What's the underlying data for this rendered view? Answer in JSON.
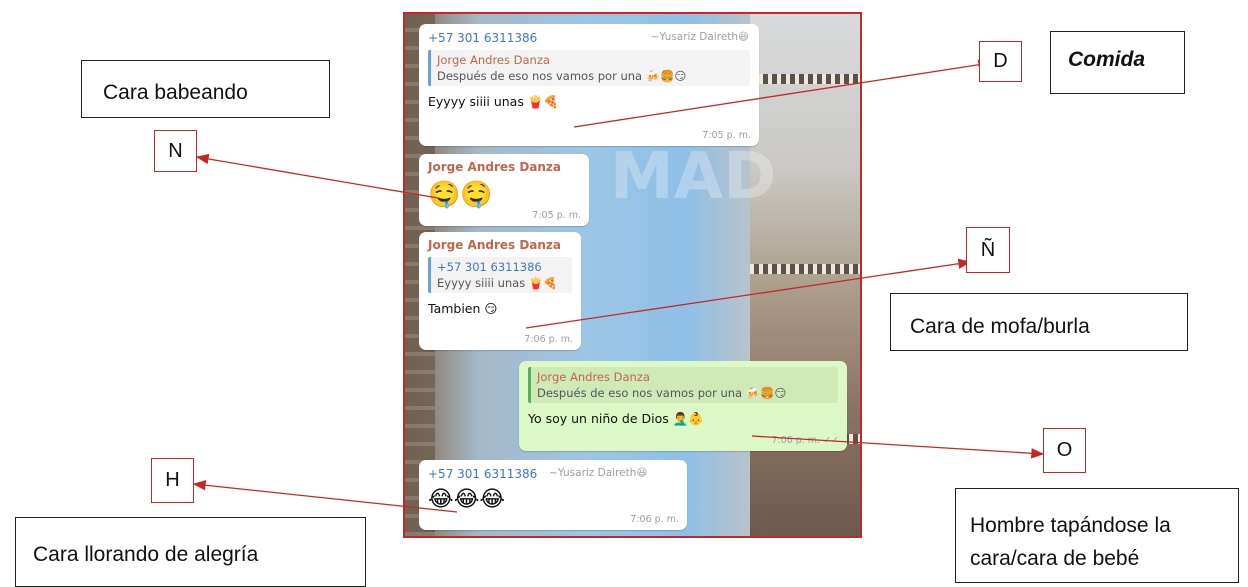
{
  "screenshot": {
    "watermark": "MAD",
    "messages": [
      {
        "phone": "+57 301 6311386",
        "alias": "~Yusariz Daireth😆",
        "quote_author": "Jorge Andres Danza",
        "quote_text": "Después de eso nos vamos por una 🍻🍔😏",
        "text": "Eyyyy siiii unas 🍟🍕",
        "time": "7:05 p. m."
      },
      {
        "author": "Jorge Andres Danza",
        "text": "🤤🤤",
        "time": "7:05 p. m."
      },
      {
        "author": "Jorge Andres Danza",
        "quote_author": "+57 301 6311386",
        "quote_text": "Eyyyy siiii unas 🍟🍕",
        "text": "Tambien 😏",
        "time": "7:06 p. m."
      },
      {
        "quote_author": "Jorge Andres Danza",
        "quote_text": "Después de eso nos vamos por una 🍻🍔😏",
        "text": "Yo soy un niño de Dios 🤦‍♂️👶",
        "time": "7:06 p. m. ✓✓"
      },
      {
        "phone": "+57 301 6311386",
        "alias": "~Yusariz Daireth😆",
        "text": "😂😂😂",
        "time": "7:06 p. m."
      }
    ]
  },
  "annotations": {
    "cara_babeando": "Cara babeando",
    "comida": "Comida",
    "cara_mofa": "Cara de mofa/burla",
    "hombre_bebe_line1": "Hombre tapándose la",
    "hombre_bebe_line2": "cara/cara de bebé",
    "cara_llorando": "Cara llorando de alegría"
  },
  "letters": {
    "n": "N",
    "d": "D",
    "enye": "Ñ",
    "o": "O",
    "h": "H"
  },
  "colors": {
    "arrow": "#c62828",
    "bubble_in": "#ffffff",
    "bubble_out": "#dcf8c6",
    "phone": "#3e78c7",
    "author": "#c0664a"
  }
}
